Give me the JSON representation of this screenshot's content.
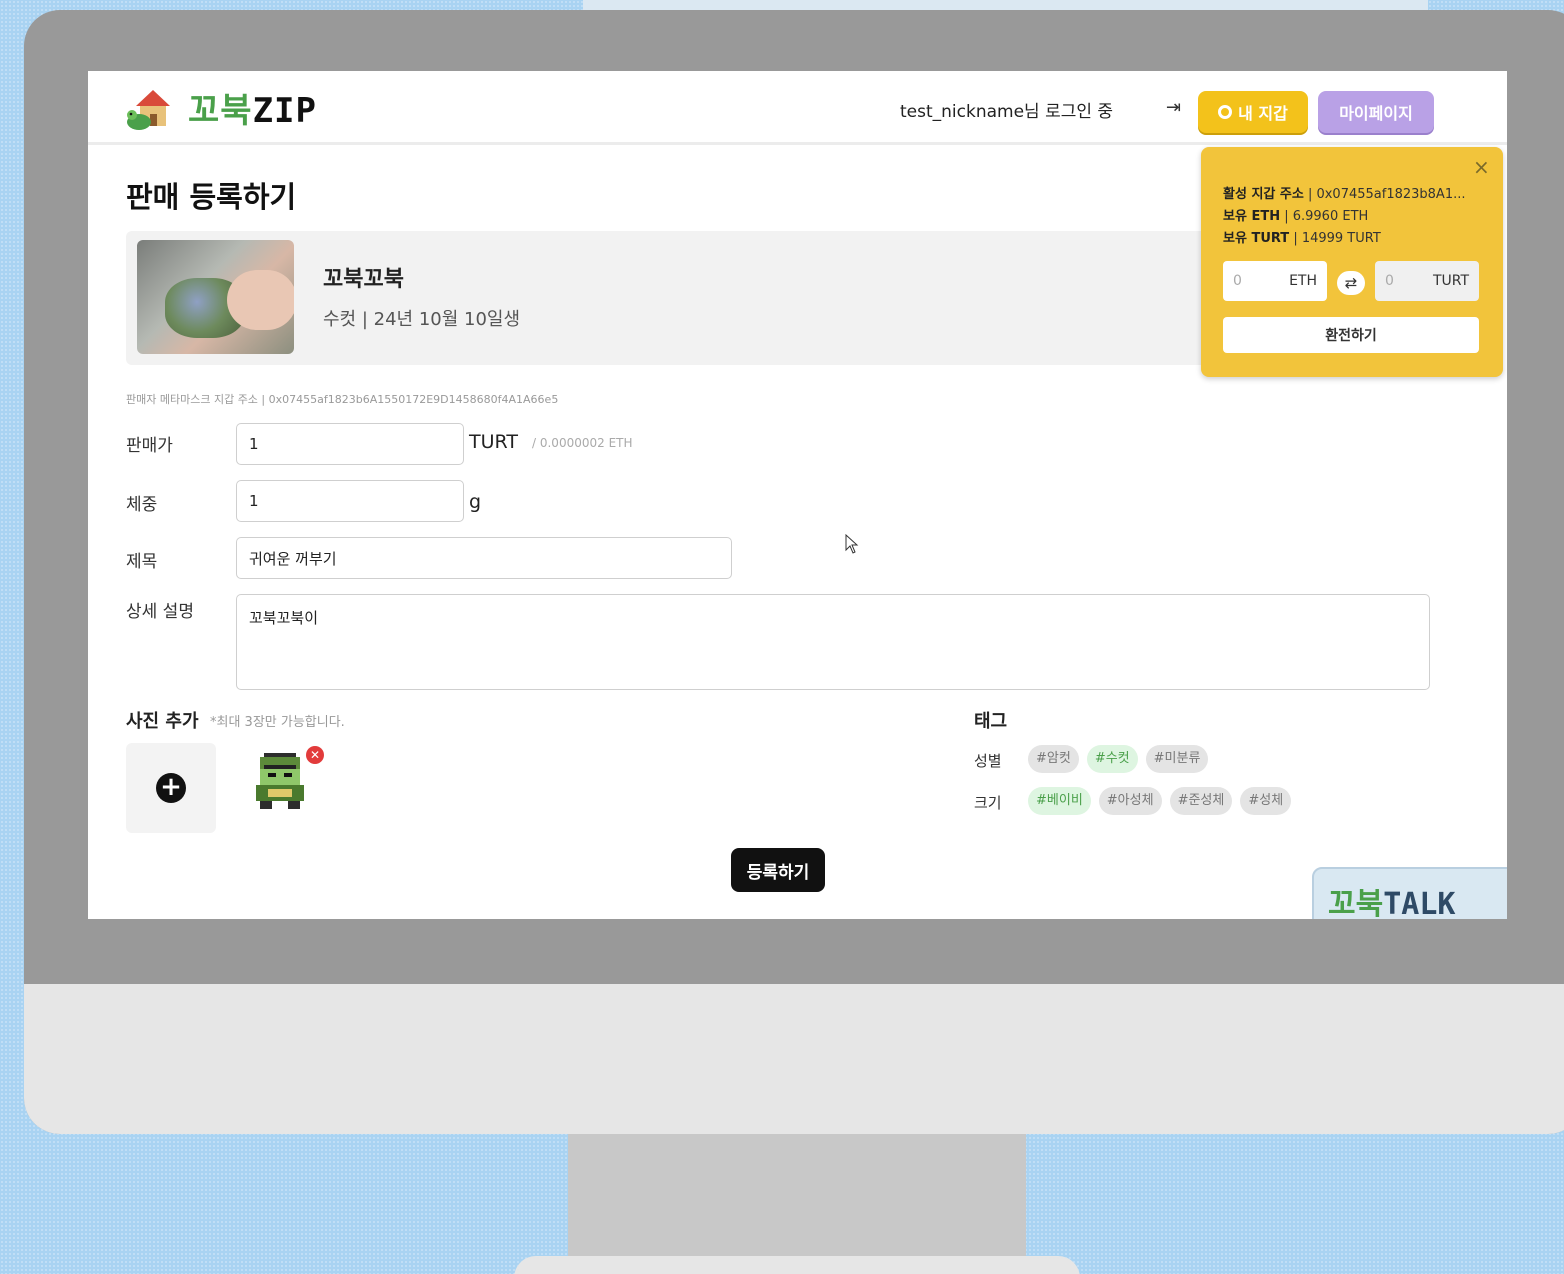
{
  "header": {
    "logo_text_a": "꼬북",
    "logo_text_b": "ZIP",
    "login_status": "test_nickname님 로그인 중",
    "wallet_button": "내 지갑",
    "mypage_button": "마이페이지"
  },
  "page_title": "판매 등록하기",
  "product": {
    "name": "꼬북꼬북",
    "meta": "수컷 | 24년 10월 10일생"
  },
  "seller_address": "판매자 메타마스크 지갑 주소 | 0x07455af1823b6A1550172E9D1458680f4A1A66e5",
  "form": {
    "price_label": "판매가",
    "price_value": "1",
    "price_unit": "TURT",
    "price_sub_unit": "/ 0.0000002 ETH",
    "weight_label": "체중",
    "weight_value": "1",
    "weight_unit": "g",
    "title_label": "제목",
    "title_value": "귀여운 꺼부기",
    "desc_label": "상세 설명",
    "desc_value": "꼬북꼬북이"
  },
  "photos": {
    "label": "사진 추가",
    "note": "*최대 3장만 가능합니다."
  },
  "tags": {
    "title": "태그",
    "gender_label": "성별",
    "gender": [
      {
        "label": "#암컷",
        "active": false
      },
      {
        "label": "#수컷",
        "active": true
      },
      {
        "label": "#미분류",
        "active": false
      }
    ],
    "size_label": "크기",
    "size": [
      {
        "label": "#베이비",
        "active": true
      },
      {
        "label": "#아성체",
        "active": false
      },
      {
        "label": "#준성체",
        "active": false
      },
      {
        "label": "#성체",
        "active": false
      }
    ]
  },
  "submit_button": "등록하기",
  "talk": {
    "text_a": "꼬북",
    "text_b": "TALK"
  },
  "wallet_popup": {
    "close": "×",
    "address_label": "활성 지갑 주소",
    "address_value": "| 0x07455af1823b8A1...",
    "eth_label": "보유 ETH",
    "eth_value": "| 6.9960 ETH",
    "turt_label": "보유 TURT",
    "turt_value": "| 14999 TURT",
    "eth_input_placeholder": "0",
    "eth_currency": "ETH",
    "turt_input_placeholder": "0",
    "turt_currency": "TURT",
    "swap_icon": "⇄",
    "exchange_button": "환전하기"
  },
  "colors": {
    "wallet_yellow": "#f2c43b",
    "mypage_purple": "#b9a1e6",
    "tag_green": "#4aa04a",
    "background_blue": "#a9d3f2"
  }
}
